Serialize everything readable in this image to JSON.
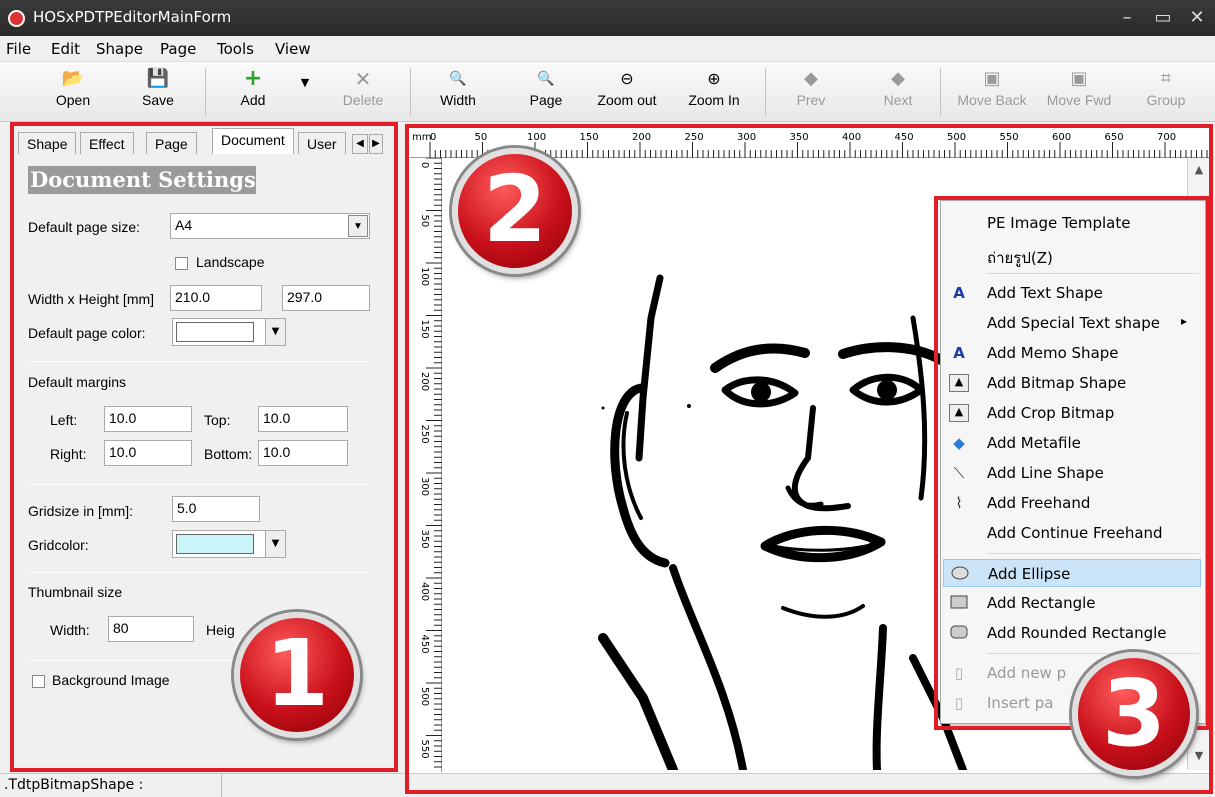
{
  "window": {
    "title": "HOSxPDTPEditorMainForm"
  },
  "menu": [
    "File",
    "Edit",
    "Shape",
    "Page",
    "Tools",
    "View"
  ],
  "toolbar": {
    "open": "Open",
    "save": "Save",
    "add": "Add",
    "delete": "Delete",
    "width": "Width",
    "page": "Page",
    "zoom_out": "Zoom out",
    "zoom_in": "Zoom In",
    "prev": "Prev",
    "next": "Next",
    "move_back": "Move Back",
    "move_fwd": "Move Fwd",
    "group": "Group"
  },
  "tabs": [
    "Shape",
    "Effect",
    "Page",
    "Document",
    "User"
  ],
  "document_settings": {
    "heading": "Document Settings",
    "default_page_size_label": "Default page size:",
    "default_page_size_value": "A4",
    "landscape_label": "Landscape",
    "width_height_label": "Width x Height [mm]",
    "width_value": "210.0",
    "height_value": "297.0",
    "default_page_color_label": "Default page color:",
    "default_page_color": "#ffffff",
    "default_margins_label": "Default margins",
    "left_label": "Left:",
    "left_value": "10.0",
    "top_label": "Top:",
    "top_value": "10.0",
    "right_label": "Right:",
    "right_value": "10.0",
    "bottom_label": "Bottom:",
    "bottom_value": "10.0",
    "gridsize_label": "Gridsize in [mm]:",
    "gridsize_value": "5.0",
    "gridcolor_label": "Gridcolor:",
    "gridcolor": "#c8f4fa",
    "thumbnail_size_label": "Thumbnail size",
    "thumb_width_label": "Width:",
    "thumb_width_value": "80",
    "thumb_height_label": "Heig",
    "background_image_label": "Background Image"
  },
  "ruler": {
    "unit": "mm",
    "top_ticks": [
      "0",
      "50",
      "100",
      "150",
      "200",
      "250",
      "300",
      "350",
      "400",
      "450",
      "500",
      "550",
      "600",
      "650",
      "700"
    ],
    "left_ticks": [
      "0",
      "50",
      "100",
      "150",
      "200",
      "250",
      "300",
      "350",
      "400",
      "450",
      "500",
      "550"
    ]
  },
  "context_menu": {
    "items": [
      {
        "label": "PE Image Template",
        "icon": "none"
      },
      {
        "label": "ถ่ายรูป(Z)",
        "icon": "none"
      },
      {
        "label": "Add Text Shape",
        "icon": "text-shape-icon"
      },
      {
        "label": "Add Special Text shape",
        "icon": "none",
        "submenu": true
      },
      {
        "label": "Add Memo Shape",
        "icon": "memo-shape-icon"
      },
      {
        "label": "Add Bitmap Shape",
        "icon": "bitmap-icon"
      },
      {
        "label": "Add Crop Bitmap",
        "icon": "crop-bitmap-icon"
      },
      {
        "label": "Add Metafile",
        "icon": "metafile-icon"
      },
      {
        "label": "Add Line Shape",
        "icon": "line-icon"
      },
      {
        "label": "Add Freehand",
        "icon": "freehand-icon"
      },
      {
        "label": "Add Continue Freehand",
        "icon": "none"
      },
      {
        "label": "Add Ellipse",
        "icon": "ellipse-icon",
        "highlighted": true
      },
      {
        "label": "Add Rectangle",
        "icon": "rectangle-icon"
      },
      {
        "label": "Add Rounded Rectangle",
        "icon": "rounded-rectangle-icon"
      },
      {
        "label": "Add new p",
        "icon": "page-icon",
        "disabled": true
      },
      {
        "label": "Insert pa",
        "icon": "page-icon",
        "disabled": true
      }
    ],
    "submenu_arrow": "▸"
  },
  "status": {
    "shape_label": ".TdtpBitmapShape :"
  },
  "annotations": {
    "badge1": "1",
    "badge2": "2",
    "badge3": "3",
    "accent": "#e11d25"
  }
}
